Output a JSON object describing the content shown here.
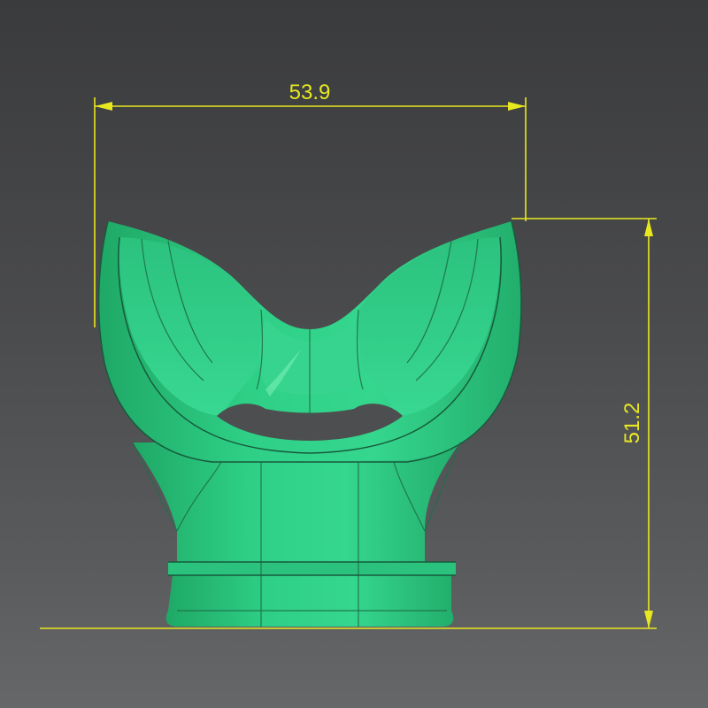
{
  "model": {
    "name": "mouthpiece",
    "body_color": "#2ecf86",
    "body_shade": "#1fa866",
    "highlight_color": "#7ff0b8",
    "edge_color": "#1f6f4a"
  },
  "dimensions": {
    "width_label": "53.9",
    "height_label": "51.2",
    "line_color": "#e8e820"
  },
  "background": {
    "top_color": "#3a3b3d",
    "bottom_color": "#666768"
  }
}
